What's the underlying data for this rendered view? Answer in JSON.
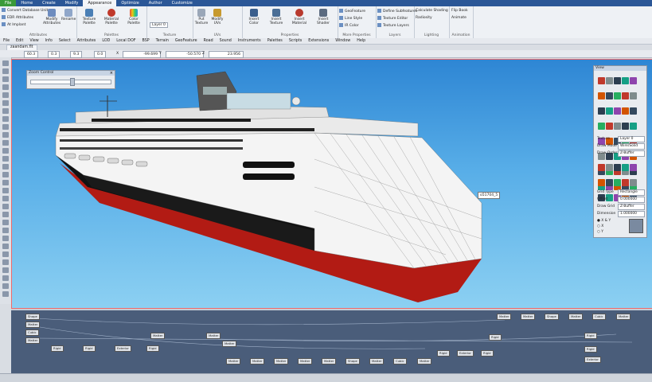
{
  "ribbon_tabs": [
    "File",
    "Home",
    "Create",
    "Modify",
    "Appearance",
    "Optimize",
    "Author",
    "Customize"
  ],
  "ribbon": {
    "groups": [
      {
        "name": "Attributes",
        "buttons": [
          "Modify Attributes",
          "Rename"
        ]
      },
      {
        "name": "Palettes",
        "buttons": [
          "Texture Palette",
          "Material Palette",
          "Color Palette"
        ]
      },
      {
        "name": "Texture",
        "buttons": [
          "Layer 0"
        ]
      },
      {
        "name": "UVs",
        "buttons": [
          "Put Texture",
          "Modify UVs"
        ]
      },
      {
        "name": "Properties",
        "buttons": [
          "Insert Color",
          "Insert Texture",
          "Insert Material",
          "Insert Shader"
        ]
      },
      {
        "name": "More Properties",
        "buttons": [
          "GeoFeature",
          "Line Style",
          "IR Color"
        ]
      },
      {
        "name": "Layers",
        "buttons": [
          "Define Subfeatures",
          "Texture Editor",
          "Texture Layers"
        ]
      },
      {
        "name": "Lighting",
        "buttons": [
          "Calculate Shading",
          "Radiosity"
        ]
      },
      {
        "name": "Animation",
        "buttons": [
          "Flip Book",
          "Animate"
        ]
      }
    ],
    "left_items": [
      "Convert Database Units",
      "EDR Attributes",
      "At Implant"
    ]
  },
  "menubar": [
    "File",
    "Edit",
    "View",
    "Info",
    "Select",
    "Attributes",
    "LOD",
    "Local DOF",
    "BSP",
    "Terrain",
    "GeoFeature",
    "Road",
    "Sound",
    "Instruments",
    "Palettes",
    "Scripts",
    "Extensions",
    "Window",
    "Help"
  ],
  "document_tab": "zaandam.flt",
  "coordbar": {
    "v1": "60.3",
    "v2": "0.3",
    "v3": "9.3",
    "v4": "0.0",
    "x_label": "X",
    "x": "-99.699",
    "y_label": "Y",
    "y": "-50.570",
    "z_label": "Z",
    "z": "23.956"
  },
  "zoom_control": {
    "title": "Zoom Control",
    "value": 0.52
  },
  "view_panel": {
    "title": "View",
    "texture_label": "Texture",
    "texture_value": "Layer 0",
    "draw_mode_label": "Draw Mode",
    "draw_mode_value": "Wire/Solid",
    "draw_order_label": "Draw Order",
    "draw_order_value": "Z-Buffer",
    "grid_type_label": "Grid Type",
    "grid_type_value": "Rectangle",
    "offset_label": "Offset",
    "offset_value": "0.000000",
    "draw_grid_label": "Draw Grid",
    "draw_grid_value": "Z-Buffer",
    "dimension_label": "Dimension",
    "dimension_value": "1.000000",
    "axes": [
      "X & Y",
      "X",
      "Y"
    ]
  },
  "floating_label": "o51704_5",
  "graph_nodes": [
    "Shape",
    "Matter",
    "Cubic",
    "Matter",
    "Rigid",
    "Rigid",
    "Exterior",
    "Rigid",
    "Matter",
    "Matter",
    "Matter",
    "Matter",
    "Matter"
  ],
  "colors": {
    "ribbon_blue": "#2b5797",
    "viewport_sky": "#58aee8",
    "hull_red": "#b21b14"
  }
}
